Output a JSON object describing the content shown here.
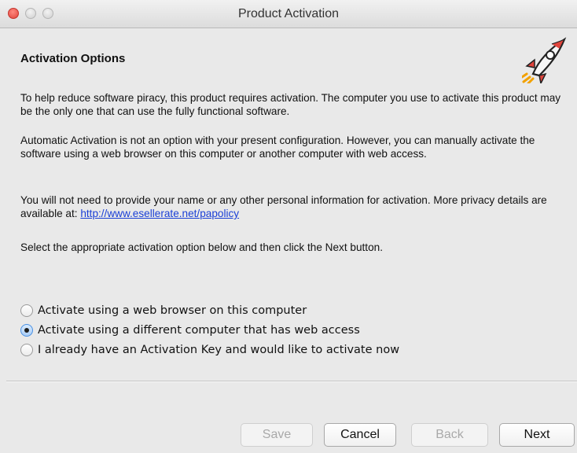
{
  "window": {
    "title": "Product Activation"
  },
  "header": {
    "heading": "Activation Options",
    "logo_icon": "rocket-icon"
  },
  "body": {
    "paragraph1": "To help reduce software piracy, this product requires activation. The computer you use to activate this product may be the only one that can use the fully functional software.",
    "paragraph2": "Automatic Activation is not an option with your present configuration. However, you can manually activate the software using a web browser on this computer or another computer with web access.",
    "paragraph3_text": "You will not need to provide your name or any other personal information for activation. More privacy details are available at: ",
    "paragraph3_link": "http://www.esellerate.net/papolicy",
    "paragraph4": "Select the appropriate activation option below and then click the Next button."
  },
  "options": [
    {
      "label": "Activate using a web browser on this computer",
      "selected": false
    },
    {
      "label": "Activate using a different computer that has web access",
      "selected": true
    },
    {
      "label": "I already have an Activation Key and would like to activate now",
      "selected": false
    }
  ],
  "buttons": {
    "save": "Save",
    "cancel": "Cancel",
    "back": "Back",
    "next": "Next"
  },
  "colors": {
    "window_bg": "#e9e9e9",
    "link": "#1a3fd6",
    "selected_radio": "#4a90e2",
    "close_button": "#e0443c"
  }
}
